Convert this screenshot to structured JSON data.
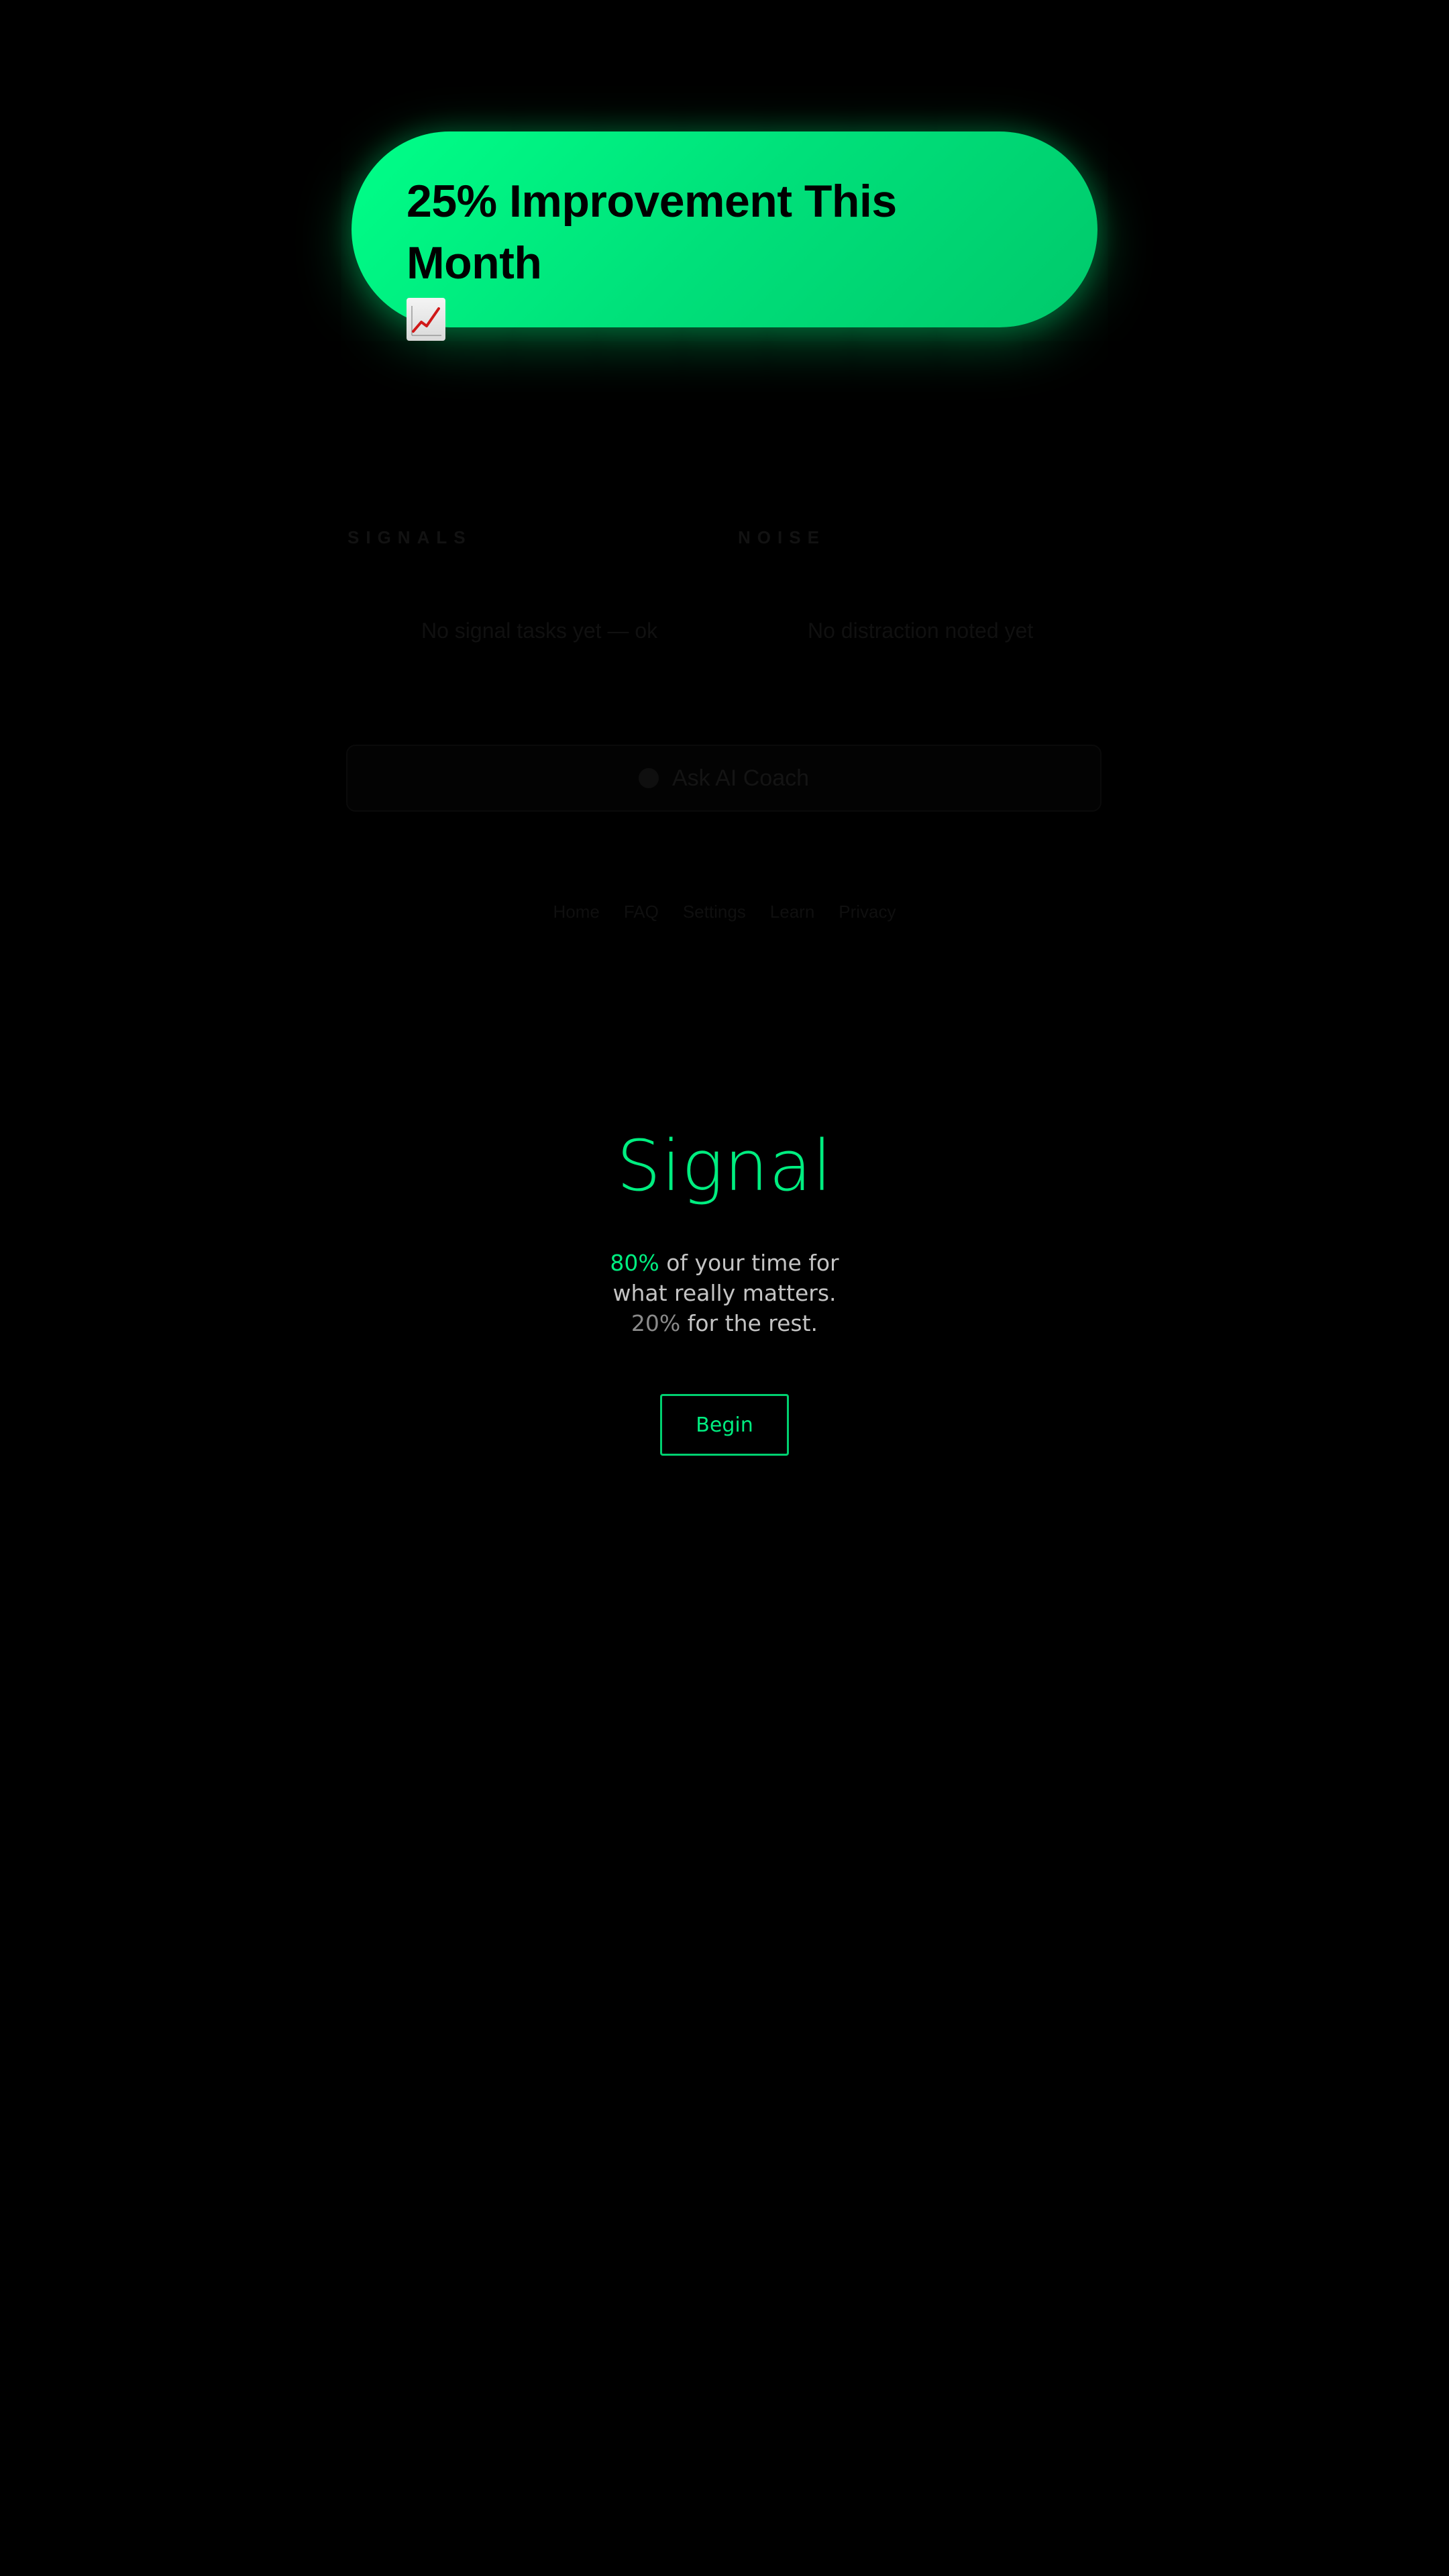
{
  "toast": {
    "title": "25% Improvement This Month",
    "icon": "chart-increasing-icon"
  },
  "background_app": {
    "columns": [
      {
        "label": "SIGNALS",
        "text": "No signal tasks yet — ok"
      },
      {
        "label": "NOISE",
        "text": "No distraction noted yet"
      }
    ],
    "ask_button": {
      "label": "Ask AI Coach",
      "icon": "sparkle-icon"
    },
    "footer_links": [
      "Home",
      "FAQ",
      "Settings",
      "Learn",
      "Privacy"
    ]
  },
  "splash": {
    "brand": "Signal",
    "tagline": {
      "line1_accent": "80%",
      "line1_rest": " of your time for",
      "line2": "what really matters.",
      "line3_muted": "20%",
      "line3_rest": " for the rest."
    },
    "begin_label": "Begin"
  },
  "colors": {
    "background": "#000000",
    "accent": "#00ee80",
    "toast_gradient_start": "#00ff88",
    "toast_gradient_end": "#00c96b"
  }
}
